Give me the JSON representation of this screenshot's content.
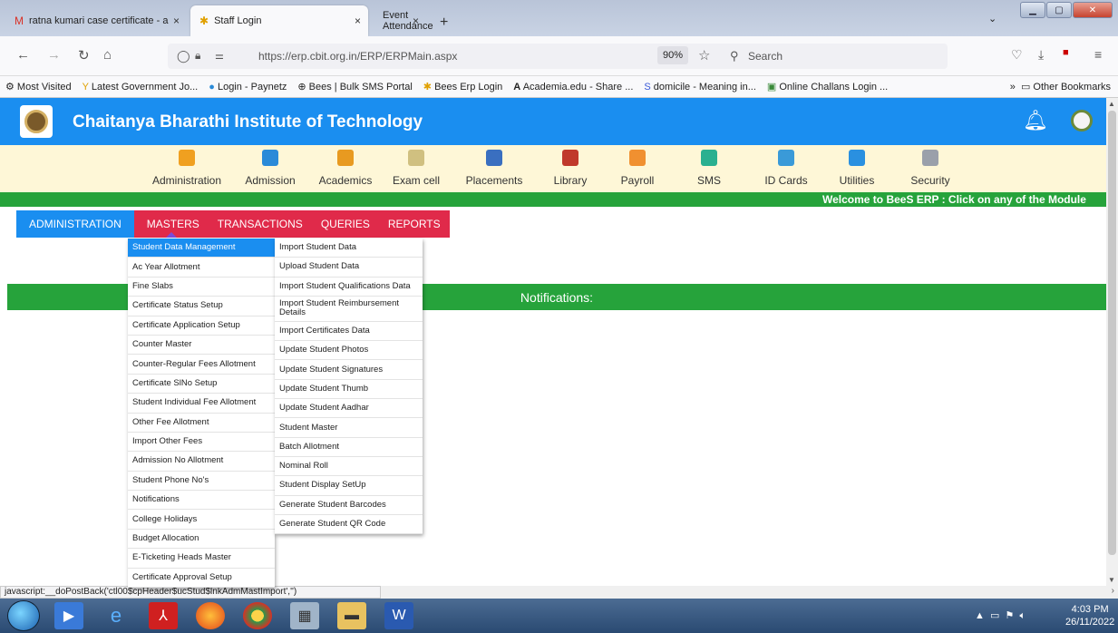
{
  "browser": {
    "tabs": [
      {
        "label": "ratna kumari case certificate - a",
        "icon": "gmail-icon"
      },
      {
        "label": "Staff Login",
        "icon": "bees-icon"
      },
      {
        "label": "Event Attendance",
        "icon": ""
      }
    ],
    "close_glyph": "×",
    "new_tab_glyph": "+",
    "url": "https://erp.cbit.org.in/ERP/ERPMain.aspx",
    "zoom": "90%",
    "search_placeholder": "Search",
    "bookmarks": [
      "Most Visited",
      "Latest Government Jo...",
      "Login - Paynetz",
      "Bees | Bulk SMS Portal",
      "Bees Erp Login",
      "Academia.edu - Share ...",
      "domicile - Meaning in...",
      "Online Challans Login ..."
    ],
    "other_bookmarks": "Other Bookmarks"
  },
  "app": {
    "title": "Chaitanya Bharathi Institute of Technology",
    "modules": [
      "Administration",
      "Admission",
      "Academics",
      "Exam cell",
      "Placements",
      "Library",
      "Payroll",
      "SMS",
      "ID Cards",
      "Utilities",
      "Security"
    ],
    "module_colors": [
      "#f0a020",
      "#2a8ad8",
      "#e89a20",
      "#d0c080",
      "#3a6fc0",
      "#c0392b",
      "#f09030",
      "#2ab090",
      "#3a9ad8",
      "#2a90e0",
      "#9aa0aa"
    ],
    "welcome": "Welcome to BeeS ERP : Click on any of the Module",
    "menu": [
      "ADMINISTRATION",
      "MASTERS",
      "TRANSACTIONS",
      "QUERIES",
      "REPORTS"
    ],
    "notifications": "Notifications:",
    "masters_items": [
      "Student Data Management",
      "Ac Year Allotment",
      "Fine Slabs",
      "Certificate Status Setup",
      "Certificate Application Setup",
      "Counter Master",
      "Counter-Regular Fees Allotment",
      "Certificate SlNo Setup",
      "Student Individual Fee Allotment",
      "Other Fee Allotment",
      "Import Other Fees",
      "Admission No Allotment",
      "Student Phone No's",
      "Notifications",
      "College Holidays",
      "Budget Allocation",
      "E-Ticketing Heads Master",
      "Certificate Approval Setup"
    ],
    "submenu_items": [
      "Import Student Data",
      "Upload Student Data",
      "Import Student Qualifications Data",
      "Import Student Reimbursement Details",
      "Import Certificates Data",
      "Update Student Photos",
      "Update Student Signatures",
      "Update Student Thumb",
      "Update Student Aadhar",
      "Student Master",
      "Batch Allotment",
      "Nominal Roll",
      "Student Display SetUp",
      "Generate Student Barcodes",
      "Generate Student QR Code"
    ]
  },
  "status": "javascript:__doPostBack('ctl00$cpHeader$ucStud$lnkAdmMastImport','')",
  "clock": {
    "time": "4:03 PM",
    "date": "26/11/2022"
  }
}
